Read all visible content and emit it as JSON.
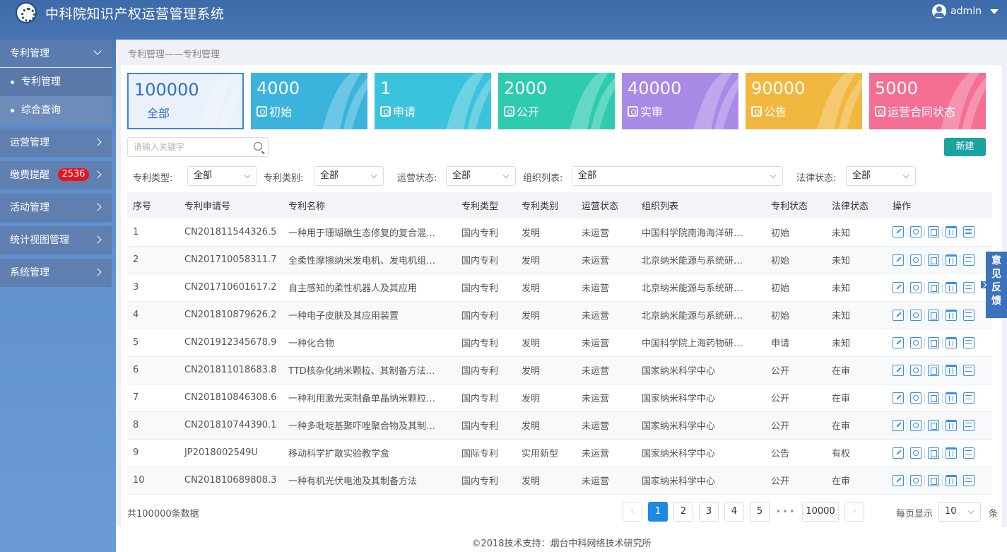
{
  "header": {
    "title": "中科院知识产权运营管理系统",
    "user": "admin"
  },
  "sidebar": {
    "groups": [
      {
        "label": "专利管理",
        "open": true,
        "children": [
          "专利管理",
          "综合查询"
        ]
      },
      {
        "label": "运营管理"
      },
      {
        "label": "缴费提醒",
        "badge": "2536"
      },
      {
        "label": "活动管理"
      },
      {
        "label": "统计视图管理"
      },
      {
        "label": "系统管理"
      }
    ]
  },
  "breadcrumb": "专利管理——专利管理",
  "cards": [
    {
      "value": "100000",
      "label": "全部",
      "color": "#eaf1fb"
    },
    {
      "value": "4000",
      "label": "初始",
      "color": "#3bb3dd"
    },
    {
      "value": "1",
      "label": "申请",
      "color": "#3ac3dc"
    },
    {
      "value": "2000",
      "label": "公开",
      "color": "#2fcbae"
    },
    {
      "value": "40000",
      "label": "实审",
      "color": "#a98ae6"
    },
    {
      "value": "90000",
      "label": "公告",
      "color": "#f1b73f"
    },
    {
      "value": "5000",
      "label": "运营合同状态",
      "color": "#f46f93"
    }
  ],
  "search": {
    "placeholder": "请输入关键字"
  },
  "new_button": "新建",
  "filters": [
    {
      "label": "专利类型:",
      "value": "全部"
    },
    {
      "label": "专利类别:",
      "value": "全部"
    },
    {
      "label": "运营状态:",
      "value": "全部"
    },
    {
      "label": "组织列表:",
      "value": "全部"
    },
    {
      "label": "法律状态:",
      "value": "全部"
    }
  ],
  "table": {
    "columns": [
      "序号",
      "专利申请号",
      "专利名称",
      "专利类型",
      "专利类别",
      "运营状态",
      "组织列表",
      "专利状态",
      "法律状态",
      "操作"
    ],
    "rows": [
      [
        "1",
        "CN201811544326.5",
        "一种用于珊瑚礁生态修复的复合混…",
        "国内专利",
        "发明",
        "未运营",
        "中国科学院南海海洋研…",
        "初始",
        "未知"
      ],
      [
        "2",
        "CN201710058311.7",
        "全柔性摩擦纳米发电机、发电机组…",
        "国内专利",
        "发明",
        "未运营",
        "北京纳米能源与系统研…",
        "初始",
        "未知"
      ],
      [
        "3",
        "CN201710601617.2",
        "自主感知的柔性机器人及其应用",
        "国内专利",
        "发明",
        "未运营",
        "北京纳米能源与系统研…",
        "初始",
        "未知"
      ],
      [
        "4",
        "CN201810879626.2",
        "一种电子皮肤及其应用装置",
        "国内专利",
        "发明",
        "未运营",
        "北京纳米能源与系统研…",
        "初始",
        "未知"
      ],
      [
        "5",
        "CN201912345678.9",
        "一种化合物",
        "国内专利",
        "发明",
        "未运营",
        "中国科学院上海药物研…",
        "申请",
        "未知"
      ],
      [
        "6",
        "CN201811018683.8",
        "TTD核杂化纳米颗粒、其制备方法…",
        "国内专利",
        "发明",
        "未运营",
        "国家纳米科学中心",
        "公开",
        "在审"
      ],
      [
        "7",
        "CN201810846308.6",
        "一种利用激光束制备单晶纳米颗粒…",
        "国内专利",
        "发明",
        "未运营",
        "国家纳米科学中心",
        "公开",
        "在审"
      ],
      [
        "8",
        "CN201810744390.1",
        "一种多吡啶基聚吓唑聚合物及其制…",
        "国内专利",
        "发明",
        "未运营",
        "国家纳米科学中心",
        "公开",
        "在审"
      ],
      [
        "9",
        "JP2018002549U",
        "移动科学扩散实验教学盒",
        "国际专利",
        "实用新型",
        "未运营",
        "国家纳米科学中心",
        "公告",
        "有权"
      ],
      [
        "10",
        "CN201810689808.3",
        "一种有机光伏电池及其制备方法",
        "国内专利",
        "发明",
        "未运营",
        "国家纳米科学中心",
        "公开",
        "在审"
      ]
    ]
  },
  "pagination": {
    "total": "共100000条数据",
    "pages": [
      "1",
      "2",
      "3",
      "4",
      "5"
    ],
    "ellipsis": "•••",
    "last": "10000",
    "per_page_label": "每页显示",
    "per_page_value": "10",
    "per_page_unit": "条"
  },
  "footer": "©2018技术支持：烟台中科网络技术研究所",
  "feedback": [
    "意",
    "见",
    "反",
    "馈"
  ]
}
